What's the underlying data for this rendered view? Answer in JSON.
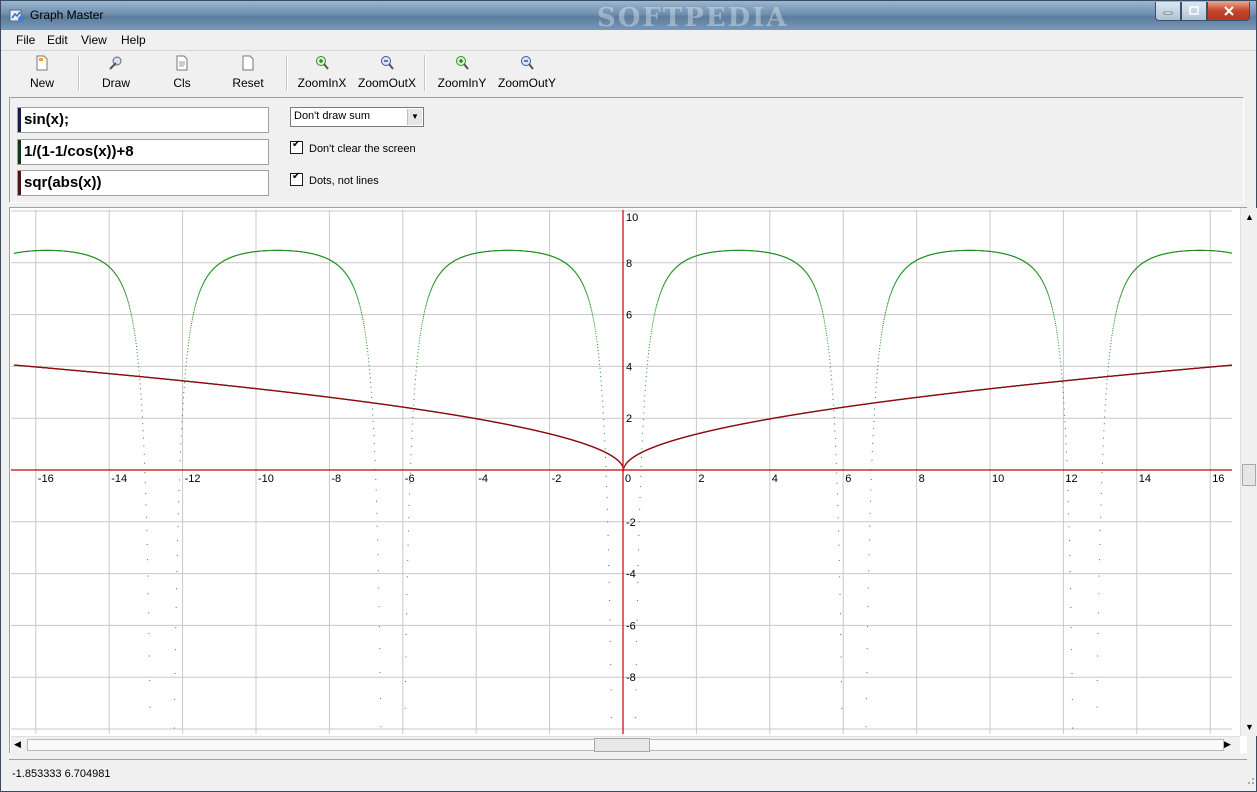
{
  "window": {
    "title": "Graph Master",
    "watermark": "SOFTPEDIA"
  },
  "menu": [
    "File",
    "Edit",
    "View",
    "Help"
  ],
  "toolbar": {
    "new": "New",
    "draw": "Draw",
    "cls": "Cls",
    "reset": "Reset",
    "zoom_in_x": "ZoomInX",
    "zoom_out_x": "ZoomOutX",
    "zoom_in_y": "ZoomInY",
    "zoom_out_y": "ZoomOutY"
  },
  "functions": [
    {
      "expr": "sin(x);",
      "color": "#1b1b4a"
    },
    {
      "expr": "1/(1-1/cos(x))+8",
      "color": "#123a12"
    },
    {
      "expr": "sqr(abs(x))",
      "color": "#4a1616"
    }
  ],
  "options": {
    "sum_mode": "Don't draw sum",
    "dont_clear": {
      "label": "Don't clear the screen",
      "checked": true
    },
    "dots": {
      "label": "Dots, not lines",
      "checked": true
    }
  },
  "graph": {
    "x_ticks": [
      "-16",
      "-14",
      "-12",
      "-10",
      "-8",
      "-6",
      "-4",
      "-2",
      "0",
      "2",
      "4",
      "6",
      "8",
      "10",
      "12",
      "14",
      "16"
    ],
    "y_ticks_pos": [
      "2",
      "4",
      "6",
      "8",
      "10"
    ],
    "y_ticks_neg": [
      "-2",
      "-4",
      "-6",
      "-8"
    ],
    "x_range": [
      -16.6,
      16.6
    ],
    "y_range": [
      -10,
      10
    ],
    "axis_color": "#cc0000",
    "grid_color": "#c8c8c8",
    "curve_colors": {
      "f2": "#1f8f1f",
      "f3": "#8b1010"
    }
  },
  "status": {
    "coords": "-1.853333 6.704981"
  }
}
